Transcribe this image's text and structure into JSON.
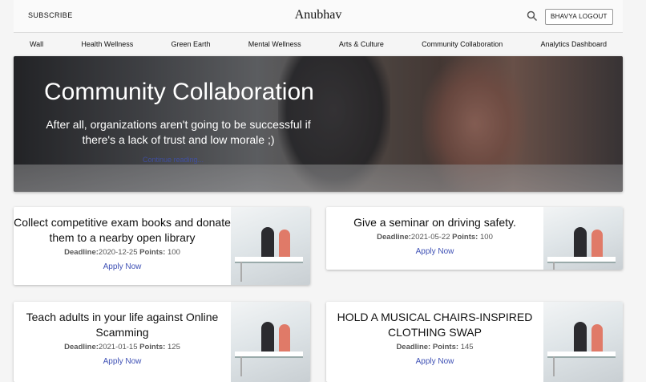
{
  "header": {
    "subscribe_label": "SUBSCRIBE",
    "brand": "Anubhav",
    "logout_label": "BHAVYA LOGOUT",
    "search_icon": "search-icon"
  },
  "nav": {
    "items": [
      "Wall",
      "Health Wellness",
      "Green Earth",
      "Mental Wellness",
      "Arts & Culture",
      "Community Collaboration",
      "Analytics Dashboard"
    ]
  },
  "hero": {
    "title": "Community Collaboration",
    "subtitle": "After all, organizations aren't going to be successful if there's a lack of trust and low morale ;)",
    "link_label": "Continue reading..."
  },
  "labels": {
    "deadline": "Deadline:",
    "points": "Points:",
    "apply": "Apply Now"
  },
  "cards": [
    {
      "title": "Collect competitive exam books and donate them to a nearby open library",
      "deadline": "2020-12-25",
      "points": "100"
    },
    {
      "title": "Give a seminar on driving safety.",
      "deadline": "2021-05-22",
      "points": "100"
    },
    {
      "title": "Teach adults in your life against Online Scamming",
      "deadline": "2021-01-15",
      "points": "125"
    },
    {
      "title": "HOLD A MUSICAL CHAIRS-INSPIRED CLOTHING SWAP",
      "deadline": "",
      "points": "145"
    }
  ],
  "colors": {
    "link": "#3f51b5",
    "background": "#f5f5f5"
  }
}
